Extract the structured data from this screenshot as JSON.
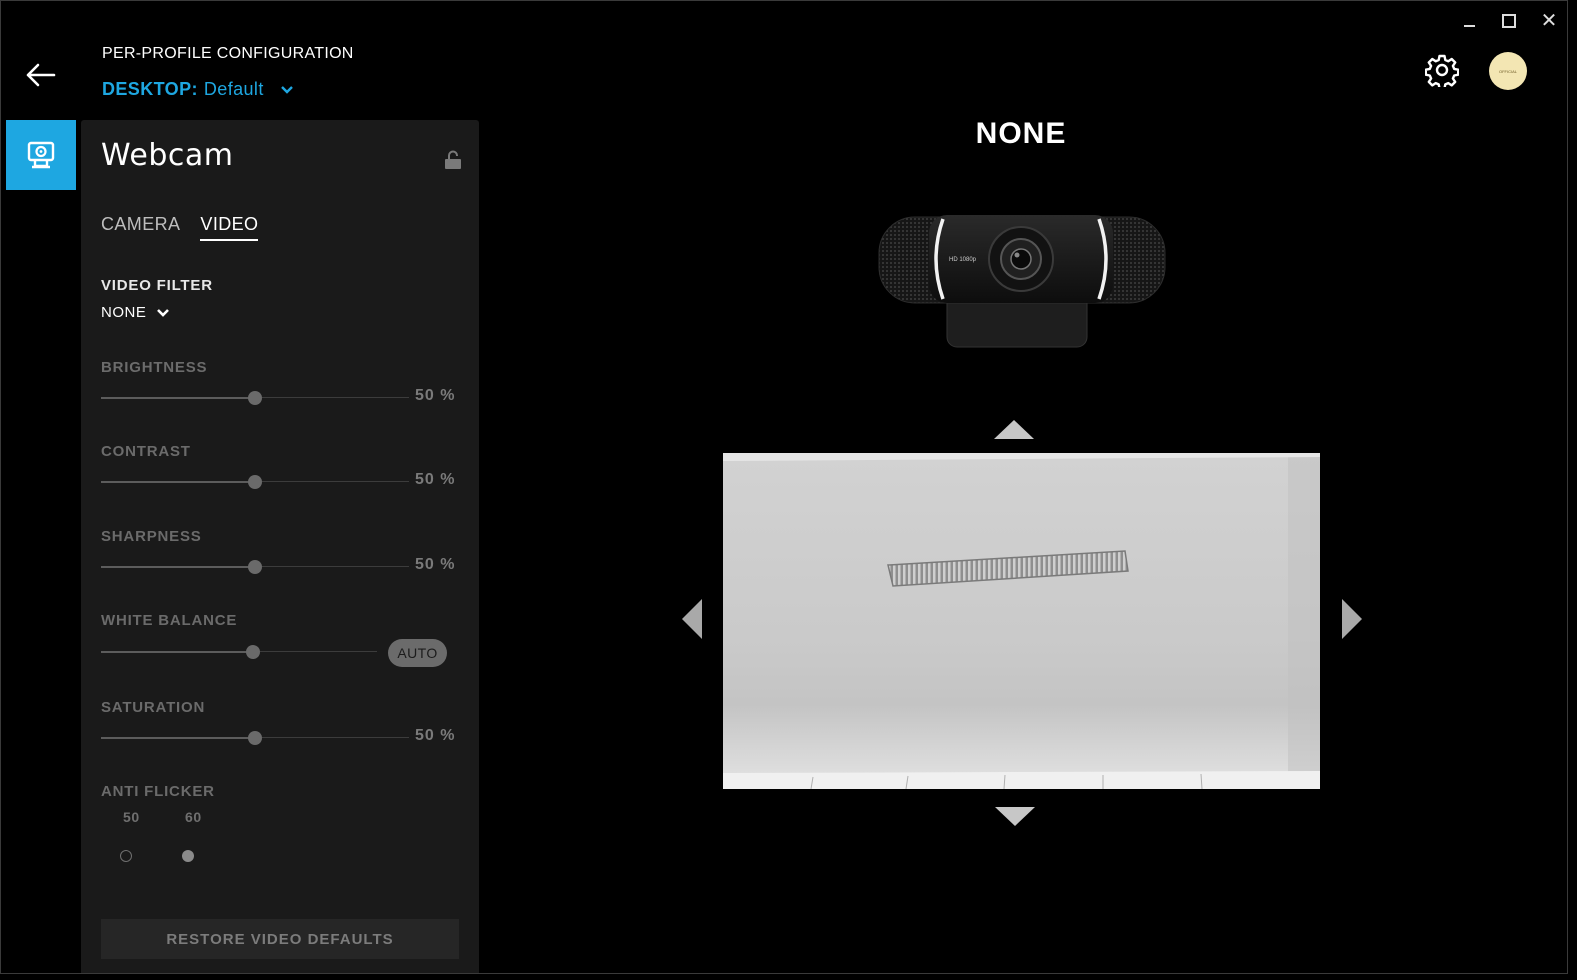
{
  "header": {
    "title": "PER-PROFILE CONFIGURATION",
    "profile_label": "DESKTOP:",
    "profile_value": "Default",
    "avatar_text": "OFFICIAL"
  },
  "panel": {
    "title": "Webcam",
    "tabs": [
      {
        "label": "CAMERA",
        "active": false
      },
      {
        "label": "VIDEO",
        "active": true
      }
    ],
    "video_filter": {
      "label": "VIDEO FILTER",
      "value": "NONE"
    },
    "sliders": {
      "brightness": {
        "label": "BRIGHTNESS",
        "value": 50,
        "display": "50 %"
      },
      "contrast": {
        "label": "CONTRAST",
        "value": 50,
        "display": "50 %"
      },
      "sharpness": {
        "label": "SHARPNESS",
        "value": 50,
        "display": "50 %"
      },
      "white_balance": {
        "label": "WHITE BALANCE",
        "value": 55,
        "auto_label": "AUTO"
      },
      "saturation": {
        "label": "SATURATION",
        "value": 50,
        "display": "50 %"
      }
    },
    "anti_flicker": {
      "label": "ANTI FLICKER",
      "options": [
        {
          "label": "50",
          "selected": false
        },
        {
          "label": "60",
          "selected": true
        }
      ]
    },
    "restore_label": "RESTORE VIDEO DEFAULTS"
  },
  "preview": {
    "filter_name": "NONE",
    "camera_badge": "HD 1080p"
  },
  "colors": {
    "accent": "#1ea7e1",
    "panel_bg": "#1a1a1a",
    "window_bg": "#000000"
  },
  "icons": [
    "back-arrow-icon",
    "chevron-down-icon",
    "gear-icon",
    "webcam-icon",
    "unlock-icon",
    "arrow-up-icon",
    "arrow-down-icon",
    "arrow-left-icon",
    "arrow-right-icon"
  ]
}
